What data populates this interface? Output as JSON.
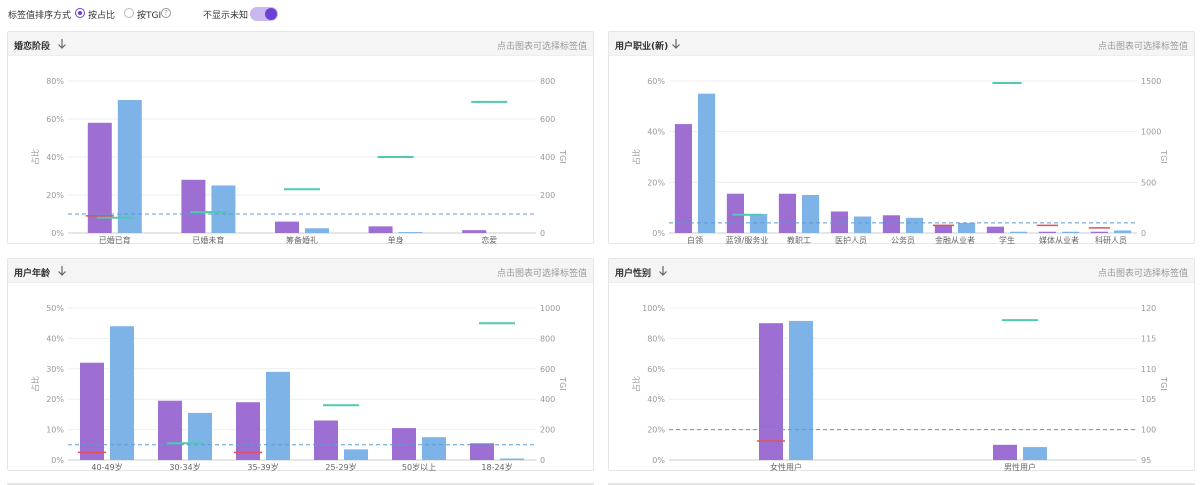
{
  "toolbar": {
    "sort_label": "标签值排序方式",
    "option_ratio": "按占比",
    "option_tgi": "按TGI",
    "help_icon": "question-icon",
    "hide_unknown_label": "不显示未知",
    "hide_unknown_on": true
  },
  "colors": {
    "ratio": "#9d6fd3",
    "tgi_bar": "#7eb3e8",
    "tgi_mark": "#4fc9b0",
    "ratio_mark": "#e0525a",
    "baseline": "#5b9bd5",
    "accent": "#6b3fd6"
  },
  "cards": [
    {
      "title": "婚恋阶段",
      "hint": "点击图表可选择标签值",
      "chart_data": {
        "type": "bar",
        "categories": [
          "已婚已育",
          "已婚未育",
          "筹备婚礼",
          "单身",
          "恋爱"
        ],
        "series": [
          {
            "axis": "ratio",
            "values": [
              58,
              28,
              6,
              3.5,
              1.5
            ]
          },
          {
            "axis": "ratio",
            "values": [
              70,
              25,
              2.5,
              0.5,
              0
            ]
          }
        ],
        "tgi": [
          80,
          110,
          230,
          400,
          690
        ],
        "ratio_ref": [
          9,
          0,
          0,
          0,
          0
        ],
        "left_ticks": [
          "0%",
          "20%",
          "40%",
          "60%",
          "80%"
        ],
        "left_max": 80,
        "right_ticks": [
          "0",
          "200",
          "400",
          "600",
          "800"
        ],
        "right_max": 800,
        "ylabel_left": "占比",
        "ylabel_right": "TGI",
        "baseline_tgi": 100
      }
    },
    {
      "title": "用户职业(新)",
      "hint": "点击图表可选择标签值",
      "chart_data": {
        "type": "bar",
        "categories": [
          "白领",
          "蓝领/服务业",
          "教职工",
          "医护人员",
          "公务员",
          "金融从业者",
          "学生",
          "媒体从业者",
          "科研人员"
        ],
        "series": [
          {
            "axis": "ratio",
            "values": [
              43,
              15.5,
              15.5,
              8.5,
              7,
              3,
              2.5,
              0.5,
              0.5
            ]
          },
          {
            "axis": "ratio",
            "values": [
              55,
              7.5,
              15,
              6.5,
              6,
              4,
              0.5,
              0.5,
              1
            ]
          }
        ],
        "tgi": [
          0,
          180,
          0,
          0,
          0,
          0,
          1480,
          0,
          0
        ],
        "ratio_ref": [
          0,
          0,
          0,
          0,
          0,
          3,
          0,
          3,
          2
        ],
        "left_ticks": [
          "0%",
          "20%",
          "40%",
          "60%"
        ],
        "left_max": 60,
        "right_ticks": [
          "0",
          "500",
          "1000",
          "1500"
        ],
        "right_max": 1500,
        "ylabel_left": "占比",
        "ylabel_right": "TGI",
        "baseline_tgi": 100
      }
    },
    {
      "title": "用户年龄",
      "hint": "点击图表可选择标签值",
      "chart_data": {
        "type": "bar",
        "categories": [
          "40-49岁",
          "30-34岁",
          "35-39岁",
          "25-29岁",
          "50岁以上",
          "18-24岁"
        ],
        "series": [
          {
            "axis": "ratio",
            "values": [
              32,
              19.5,
              19,
              13,
              10.5,
              5.5
            ]
          },
          {
            "axis": "ratio",
            "values": [
              44,
              15.5,
              29,
              3.5,
              7.5,
              0.5
            ]
          }
        ],
        "tgi": [
          0,
          110,
          0,
          360,
          0,
          900
        ],
        "ratio_ref": [
          2.5,
          0,
          2.5,
          0,
          0,
          0
        ],
        "left_ticks": [
          "0%",
          "10%",
          "20%",
          "30%",
          "40%",
          "50%"
        ],
        "left_max": 50,
        "right_ticks": [
          "0",
          "200",
          "400",
          "600",
          "800",
          "1000"
        ],
        "right_max": 1000,
        "ylabel_left": "占比",
        "ylabel_right": "TGI",
        "baseline_tgi": 100
      }
    },
    {
      "title": "用户性别",
      "hint": "点击图表可选择标签值",
      "chart_data": {
        "type": "bar",
        "categories": [
          "女性用户",
          "男性用户"
        ],
        "series": [
          {
            "axis": "ratio",
            "values": [
              90,
              10
            ]
          },
          {
            "axis": "ratio",
            "values": [
              91.5,
              8.5
            ]
          }
        ],
        "tgi": [
          0,
          118
        ],
        "ratio_ref": [
          12.5,
          0
        ],
        "left_ticks": [
          "0%",
          "20%",
          "40%",
          "60%",
          "80%",
          "100%"
        ],
        "left_max": 100,
        "right_ticks": [
          "95",
          "100",
          "105",
          "110",
          "115",
          "120"
        ],
        "right_min": 95,
        "right_max": 120,
        "ylabel_left": "占比",
        "ylabel_right": "TGI",
        "baseline_tgi": 100
      }
    }
  ]
}
